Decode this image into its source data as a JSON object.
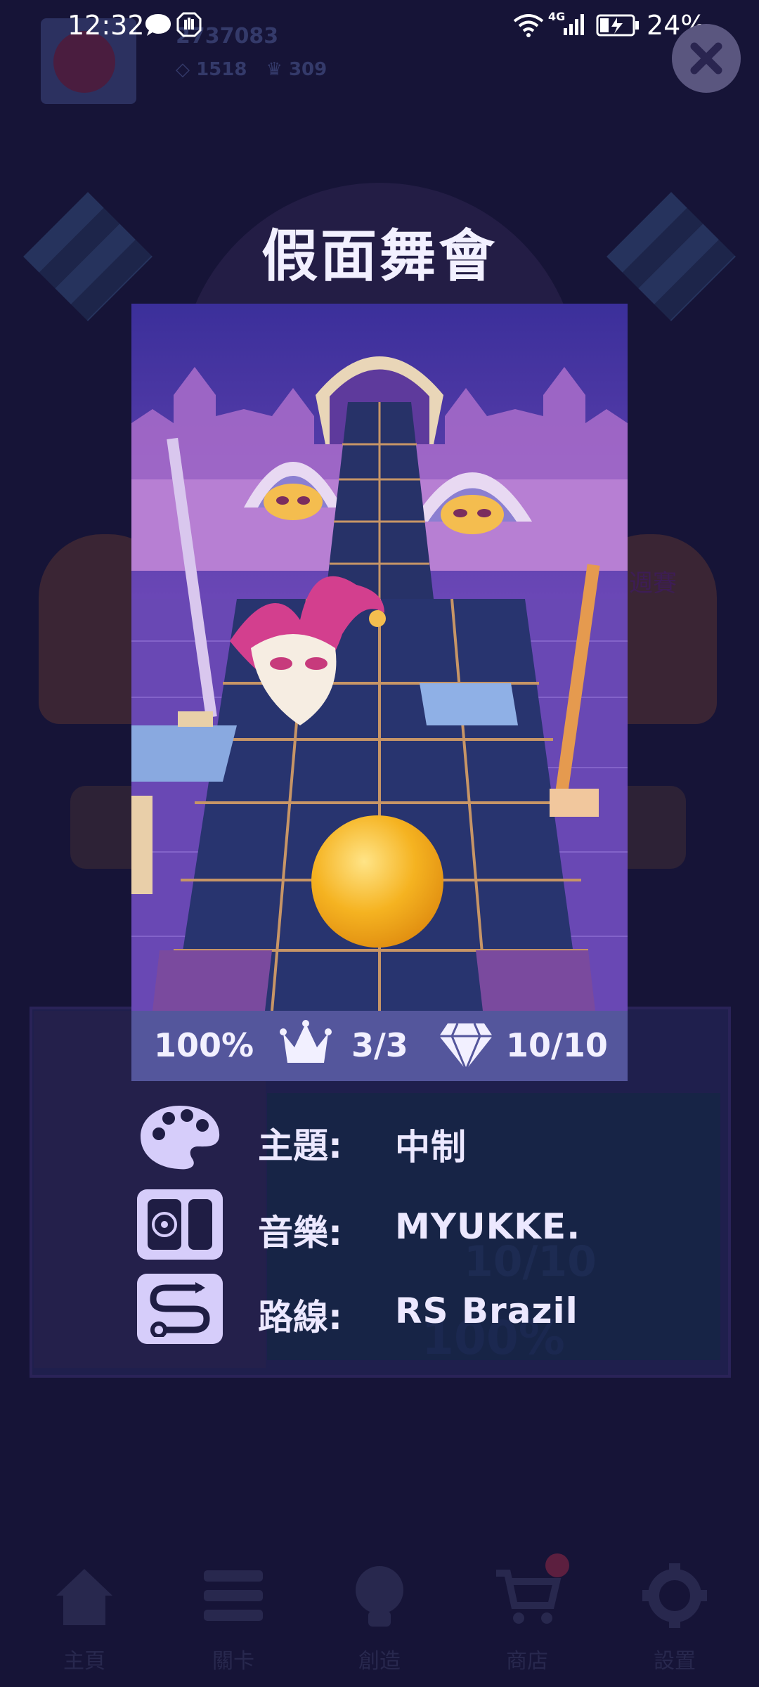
{
  "status_bar": {
    "time": "12:32",
    "battery": "24%",
    "network": "4G"
  },
  "background": {
    "score": "2737083",
    "gems": "1518",
    "crowns": "309",
    "weekly_label": "週賽",
    "faded_gems": "10/10",
    "faded_percent": "100%"
  },
  "dialog": {
    "title": "假面舞會",
    "stats": {
      "percent": "100%",
      "crowns": "3/3",
      "gems": "10/10"
    },
    "info": [
      {
        "icon": "palette-icon",
        "label": "主題:",
        "value": "中制"
      },
      {
        "icon": "music-player-icon",
        "label": "音樂:",
        "value": "MYUKKE."
      },
      {
        "icon": "route-icon",
        "label": "路線:",
        "value": "RS Brazil"
      }
    ]
  },
  "bottom_nav": [
    {
      "icon": "home-icon",
      "label": "主頁"
    },
    {
      "icon": "list-icon",
      "label": "關卡"
    },
    {
      "icon": "lightbulb-icon",
      "label": "創造"
    },
    {
      "icon": "cart-icon",
      "label": "商店"
    },
    {
      "icon": "gear-icon",
      "label": "設置"
    }
  ],
  "colors": {
    "background": "#161437",
    "stats_bar": "#54569c",
    "icon_tile": "#d6cdfa",
    "ball": "#f5b321"
  }
}
